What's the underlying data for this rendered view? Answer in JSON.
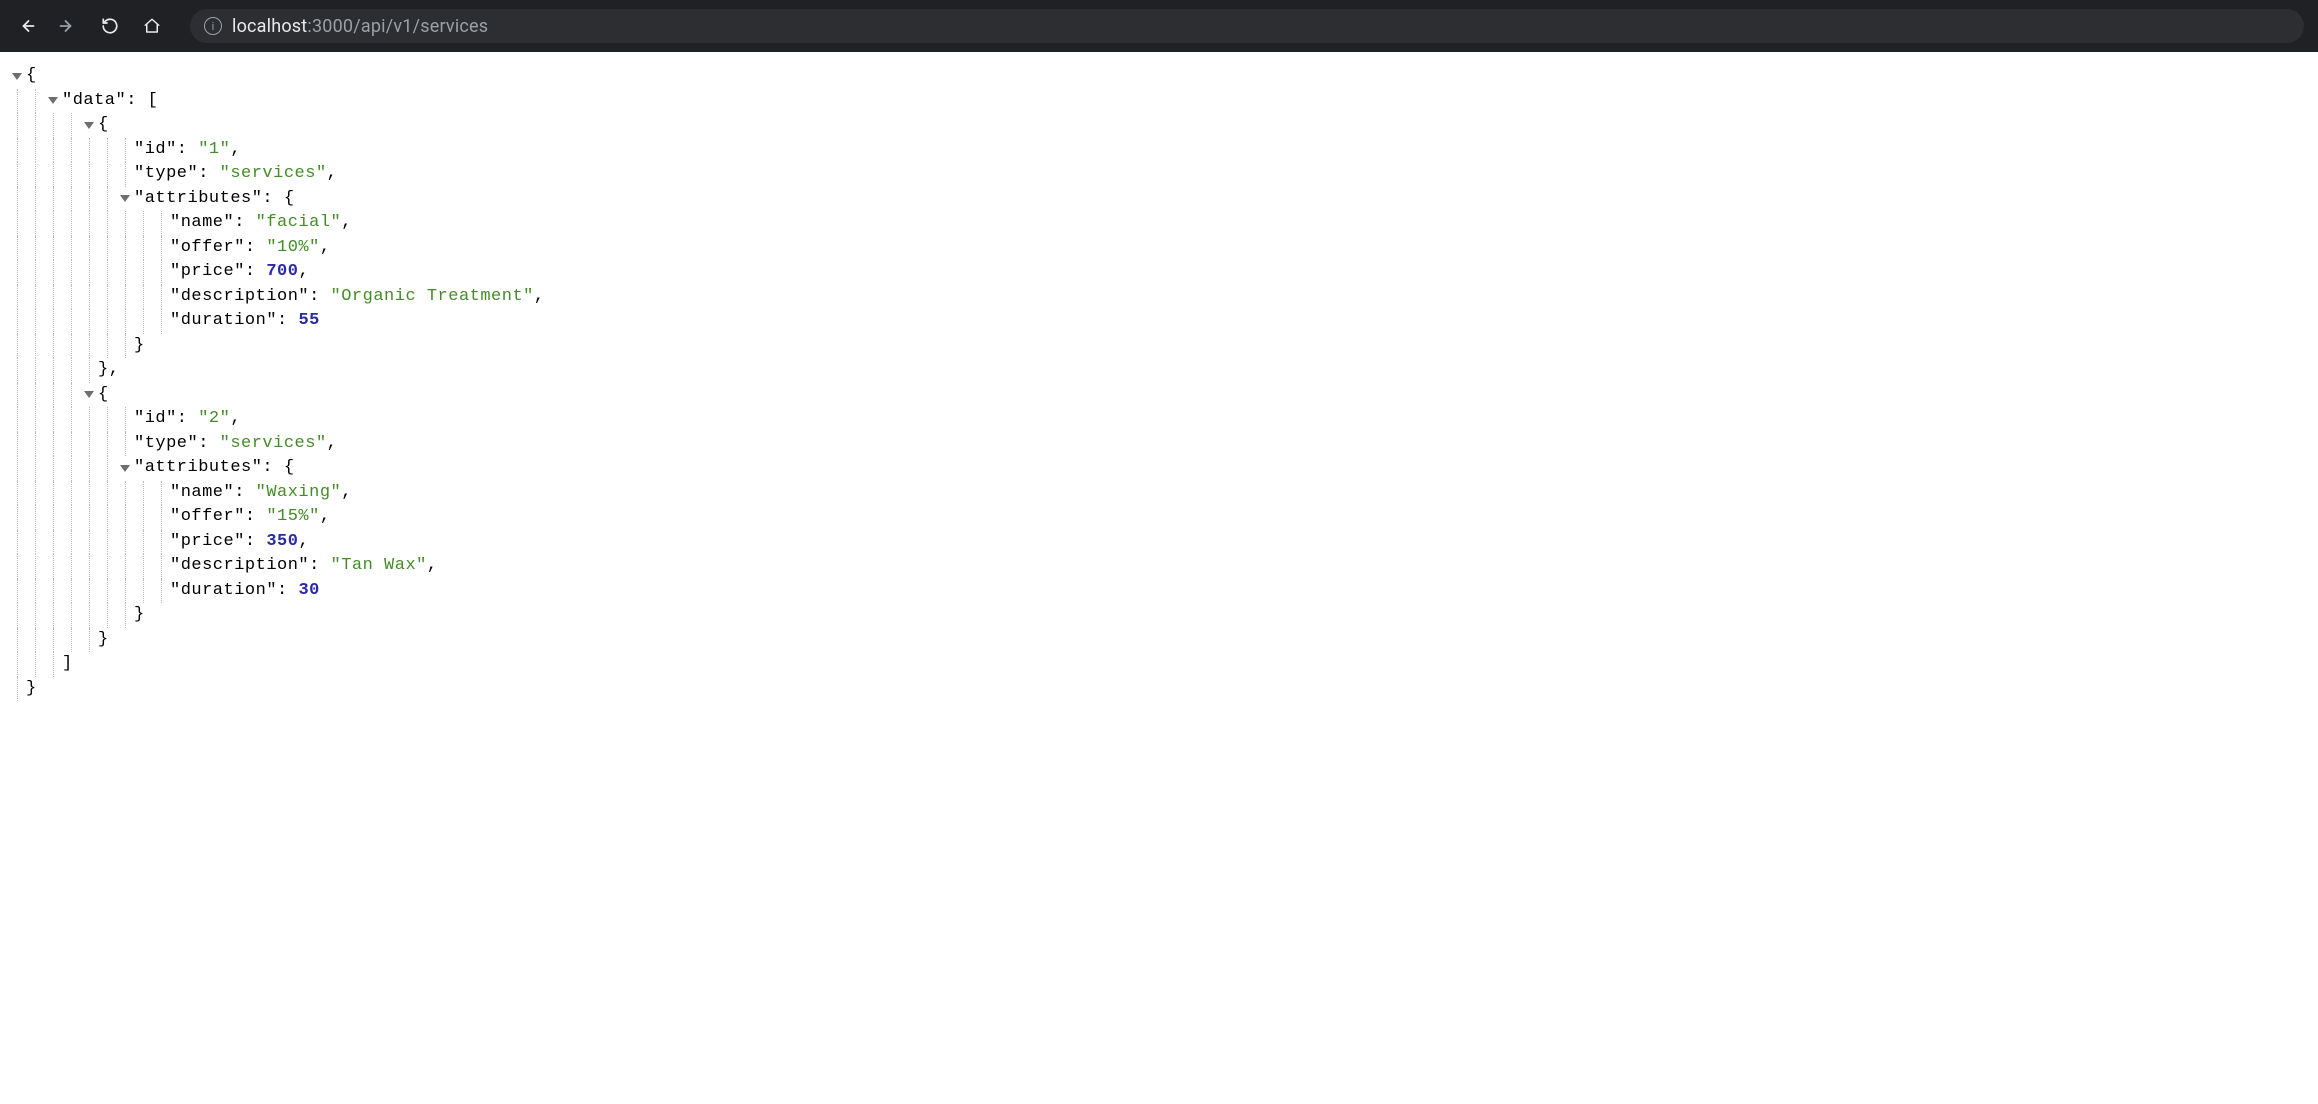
{
  "browser": {
    "url_host": "localhost",
    "url_port": ":3000",
    "url_path": "/api/v1/services"
  },
  "json": {
    "data_key": "data",
    "id_key": "id",
    "type_key": "type",
    "attributes_key": "attributes",
    "name_key": "name",
    "offer_key": "offer",
    "price_key": "price",
    "description_key": "description",
    "duration_key": "duration",
    "type_value": "services",
    "items": [
      {
        "id": "1",
        "name": "facial",
        "offer": "10%",
        "price": 700,
        "description": "Organic Treatment",
        "duration": 55
      },
      {
        "id": "2",
        "name": "Waxing",
        "offer": "15%",
        "price": 350,
        "description": "Tan Wax",
        "duration": 30
      }
    ]
  }
}
